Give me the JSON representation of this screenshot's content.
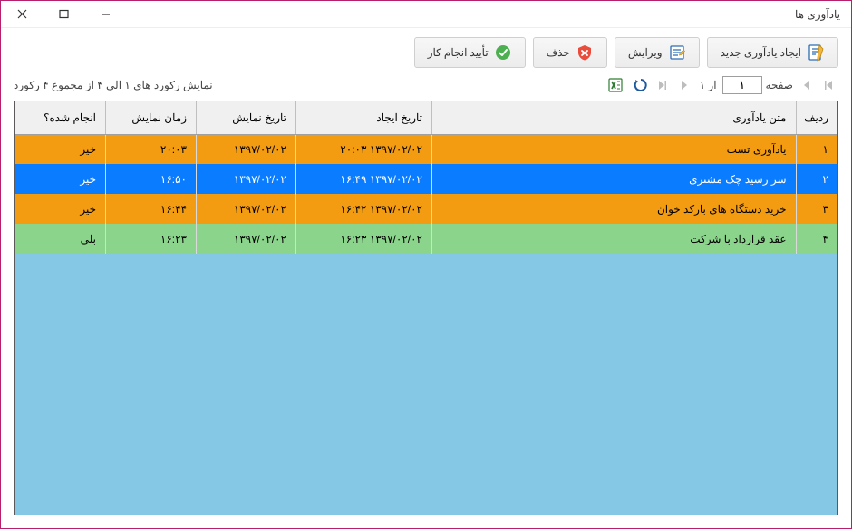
{
  "window": {
    "title": "یادآوری ها"
  },
  "toolbar": {
    "new_label": "ایجاد یادآوری جدید",
    "edit_label": "ویرایش",
    "delete_label": "حذف",
    "confirm_label": "تأیید انجام کار"
  },
  "pagination": {
    "page_label": "صفحه",
    "page_value": "۱",
    "of_total": "از ۱",
    "status": "نمایش رکورد های ۱ الی ۴ از مجموع ۴ رکورد"
  },
  "columns": {
    "rowno": "ردیف",
    "text": "متن یادآوری",
    "created": "تاریخ ایجاد",
    "show_date": "تاریخ نمایش",
    "show_time": "زمان نمایش",
    "done": "انجام شده؟"
  },
  "rows": [
    {
      "class": "orange",
      "no": "۱",
      "text": "یادآوری تست",
      "created": "۱۳۹۷/۰۲/۰۲ ۲۰:۰۳",
      "show_date": "۱۳۹۷/۰۲/۰۲",
      "show_time": "۲۰:۰۳",
      "done": "خیر"
    },
    {
      "class": "blue",
      "no": "۲",
      "text": "سر رسید چک مشتری",
      "created": "۱۳۹۷/۰۲/۰۲ ۱۶:۴۹",
      "show_date": "۱۳۹۷/۰۲/۰۲",
      "show_time": "۱۶:۵۰",
      "done": "خیر"
    },
    {
      "class": "orange",
      "no": "۳",
      "text": "خرید دستگاه های بارکد خوان",
      "created": "۱۳۹۷/۰۲/۰۲ ۱۶:۴۲",
      "show_date": "۱۳۹۷/۰۲/۰۲",
      "show_time": "۱۶:۴۴",
      "done": "خیر"
    },
    {
      "class": "green",
      "no": "۴",
      "text": "عقد قرارداد با شرکت",
      "created": "۱۳۹۷/۰۲/۰۲ ۱۶:۲۳",
      "show_date": "۱۳۹۷/۰۲/۰۲",
      "show_time": "۱۶:۲۳",
      "done": "بلی"
    }
  ]
}
